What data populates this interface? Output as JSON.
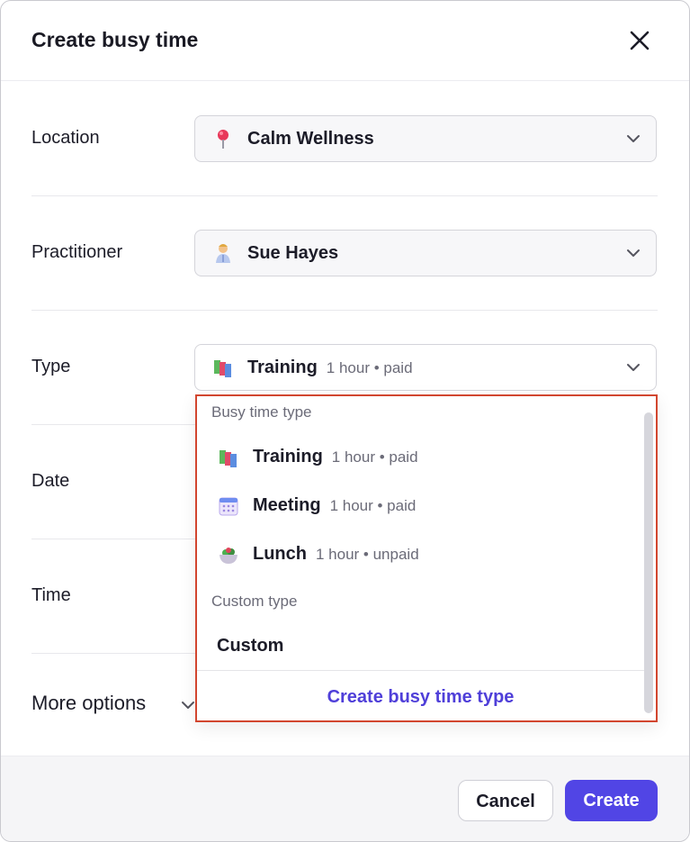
{
  "dialog": {
    "title": "Create busy time",
    "close_icon": "close-icon"
  },
  "form": {
    "location": {
      "label": "Location",
      "value": "Calm Wellness",
      "icon": "pin-icon"
    },
    "practitioner": {
      "label": "Practitioner",
      "value": "Sue Hayes",
      "icon": "person-icon"
    },
    "type": {
      "label": "Type",
      "value": "Training",
      "meta": "1 hour • paid",
      "icon": "books-icon"
    },
    "date": {
      "label": "Date"
    },
    "time": {
      "label": "Time"
    },
    "more_options": "More options"
  },
  "dropdown": {
    "busy_group_label": "Busy time type",
    "options": [
      {
        "name": "Training",
        "meta": "1 hour • paid",
        "icon": "books-icon"
      },
      {
        "name": "Meeting",
        "meta": "1 hour • paid",
        "icon": "calendar-icon"
      },
      {
        "name": "Lunch",
        "meta": "1 hour • unpaid",
        "icon": "salad-bowl-icon"
      }
    ],
    "custom_group_label": "Custom type",
    "custom_option": "Custom",
    "create_link": "Create busy time type"
  },
  "footer": {
    "cancel": "Cancel",
    "create": "Create"
  },
  "colors": {
    "accent": "#5145e5",
    "highlight_border": "#d2462f"
  }
}
